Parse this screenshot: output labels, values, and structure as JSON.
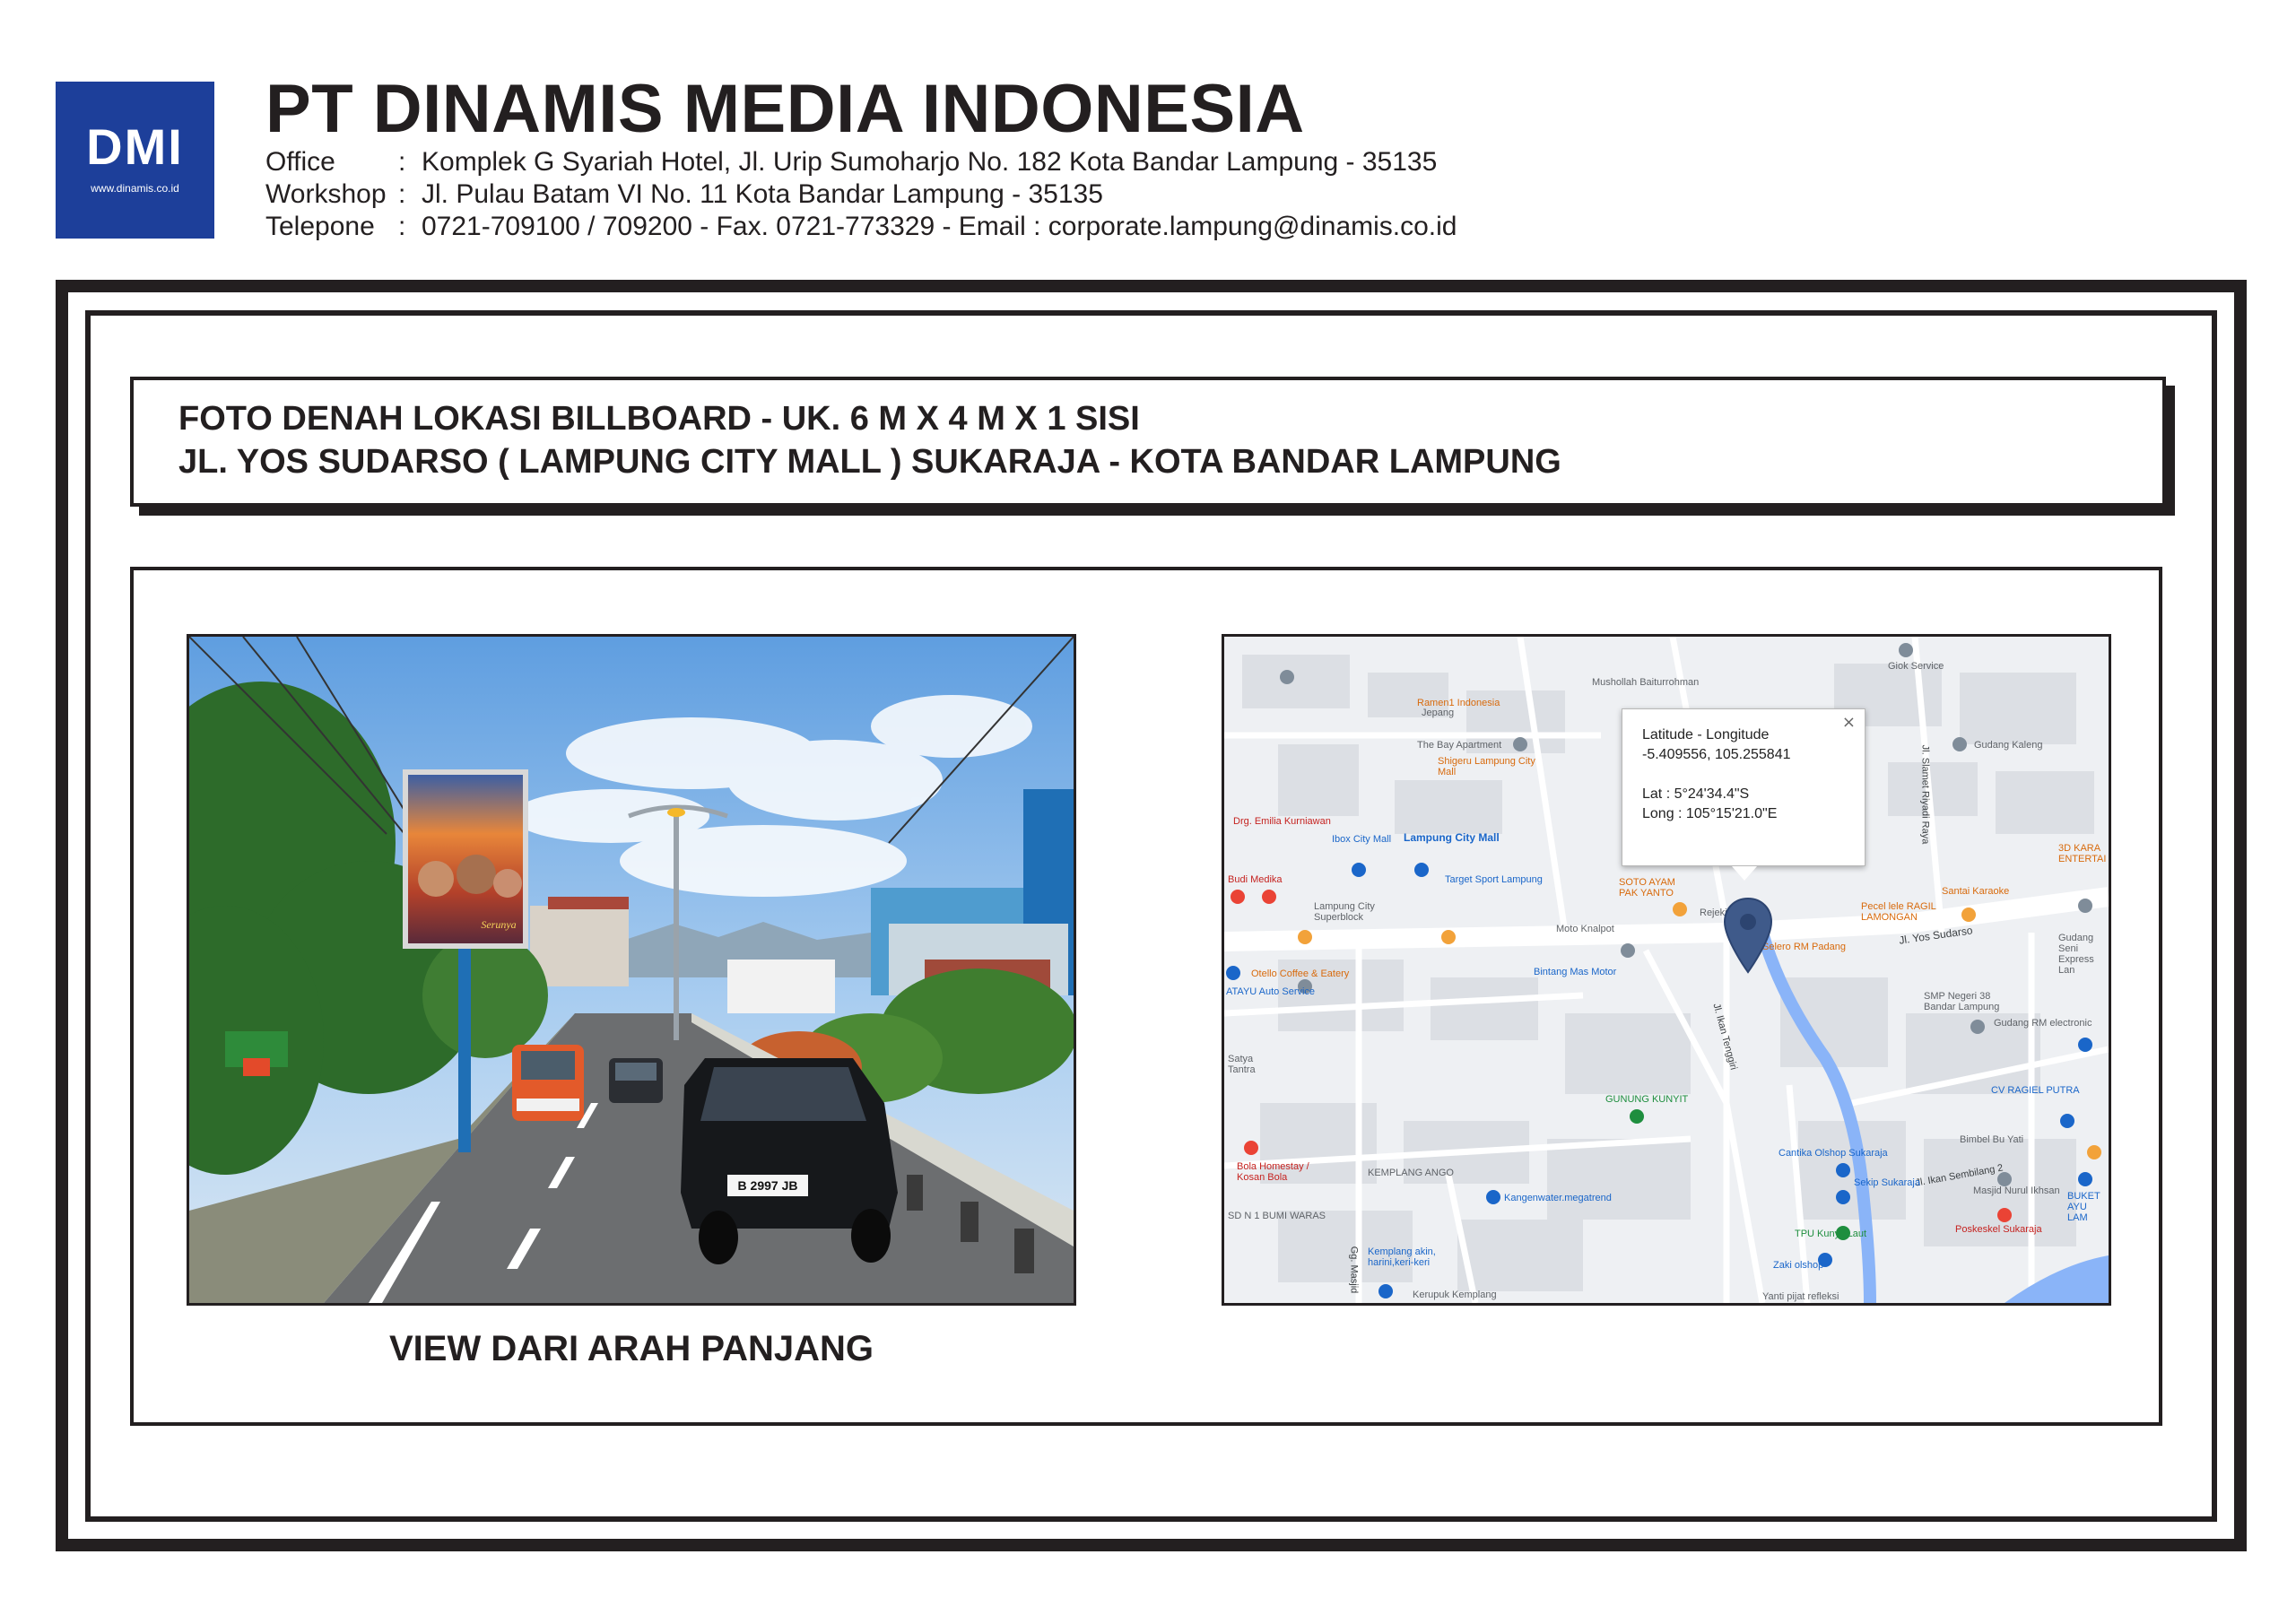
{
  "header": {
    "logo_text": "DMI",
    "logo_url": "www.dinamis.co.id",
    "company_name": "PT DINAMIS MEDIA INDONESIA",
    "office_label": "Office",
    "office_value": "Komplek G Syariah Hotel, Jl. Urip Sumoharjo No. 182 Kota Bandar Lampung - 35135",
    "workshop_label": "Workshop",
    "workshop_value": "Jl. Pulau Batam VI No. 11 Kota Bandar Lampung - 35135",
    "phone_label": "Telepone",
    "phone_value": "0721-709100 / 709200 - Fax. 0721-773329 - Email : corporate.lampung@dinamis.co.id",
    "separator": ":"
  },
  "title": {
    "line1": "FOTO DENAH LOKASI BILLBOARD - UK. 6 M X 4 M X 1 SISI",
    "line2": "JL. YOS SUDARSO ( LAMPUNG CITY MALL ) SUKARAJA - KOTA BANDAR LAMPUNG"
  },
  "photo": {
    "caption": "VIEW DARI ARAH PANJANG",
    "billboard_text": "Serunya",
    "plate": "B 2997 JB"
  },
  "map": {
    "popup": {
      "line1": "Latitude - Longitude",
      "line2": "-5.409556, 105.255841",
      "line3": "Lat : 5°24'34.4\"S",
      "line4": "Long : 105°15'21.0\"E",
      "close": "×"
    },
    "road_labels": [
      "Jl. Yos Sudarso",
      "Jl. Ikan Tenggiri",
      "Jl. Slamet Riyadi Raya",
      "Jl. Ikan Sembilang 2",
      "Gg. Masjid"
    ],
    "places": [
      {
        "name": "Mushollah Baiturrohman",
        "cls": "lbl-gray"
      },
      {
        "name": "Giok Service",
        "cls": "lbl-gray"
      },
      {
        "name": "Ramen1 Indonesia",
        "cls": "lbl-orange"
      },
      {
        "name": "Jepang",
        "cls": "lbl-gray"
      },
      {
        "name": "The Bay Apartment",
        "cls": "lbl-gray"
      },
      {
        "name": "Shigeru Lampung City Mall",
        "cls": "lbl-orange"
      },
      {
        "name": "Gudang Kaleng",
        "cls": "lbl-gray"
      },
      {
        "name": "Drg. Emilia Kurniawan",
        "cls": "lbl-red"
      },
      {
        "name": "Ibox City Mall",
        "cls": "lbl-blue"
      },
      {
        "name": "Lampung City Mall",
        "cls": "lbl-blue"
      },
      {
        "name": "Target Sport Lampung",
        "cls": "lbl-blue"
      },
      {
        "name": "Budi Medika",
        "cls": "lbl-red"
      },
      {
        "name": "Lampung City Superblock",
        "cls": "lbl-gray"
      },
      {
        "name": "SOTO AYAM PAK YANTO",
        "cls": "lbl-orange"
      },
      {
        "name": "Moto Knalpot",
        "cls": "lbl-gray"
      },
      {
        "name": "Rejeki C",
        "cls": "lbl-gray"
      },
      {
        "name": "Selero RM Padang",
        "cls": "lbl-orange"
      },
      {
        "name": "Pecel lele RAGIL LAMONGAN",
        "cls": "lbl-orange"
      },
      {
        "name": "Santai Karaoke",
        "cls": "lbl-orange"
      },
      {
        "name": "3D KARA ENTERTAI",
        "cls": "lbl-orange"
      },
      {
        "name": "Gudang Seni Express Lan",
        "cls": "lbl-gray"
      },
      {
        "name": "Otello Coffee & Eatery",
        "cls": "lbl-orange"
      },
      {
        "name": "ATAYU Auto Service",
        "cls": "lbl-blue"
      },
      {
        "name": "Bintang Mas Motor",
        "cls": "lbl-blue"
      },
      {
        "name": "SMP Negeri 38 Bandar Lampung",
        "cls": "lbl-gray"
      },
      {
        "name": "Gudang RM electronic",
        "cls": "lbl-gray"
      },
      {
        "name": "Satya Tantra",
        "cls": "lbl-gray"
      },
      {
        "name": "GUNUNG KUNYIT",
        "cls": "lbl-green"
      },
      {
        "name": "CV RAGIEL PUTRA",
        "cls": "lbl-blue"
      },
      {
        "name": "Bimbel Bu Yati",
        "cls": "lbl-gray"
      },
      {
        "name": "Bola Homestay / Kosan Bola",
        "cls": "lbl-red"
      },
      {
        "name": "KEMPLANG ANGO",
        "cls": "lbl-gray"
      },
      {
        "name": "Cantika Olshop Sukaraja",
        "cls": "lbl-blue"
      },
      {
        "name": "Sekip Sukaraja",
        "cls": "lbl-blue"
      },
      {
        "name": "Masjid Nurul Ikhsan",
        "cls": "lbl-gray"
      },
      {
        "name": "BUKET AYU LAM",
        "cls": "lbl-blue"
      },
      {
        "name": "Kangenwater.megatrend",
        "cls": "lbl-blue"
      },
      {
        "name": "SD N 1 BUMI WARAS",
        "cls": "lbl-gray"
      },
      {
        "name": "Poskeskel Sukaraja",
        "cls": "lbl-red"
      },
      {
        "name": "TPU Kunyit Laut",
        "cls": "lbl-green"
      },
      {
        "name": "Kemplang akin, harini,keri-keri",
        "cls": "lbl-blue"
      },
      {
        "name": "Zaki olshop",
        "cls": "lbl-blue"
      },
      {
        "name": "Kerupuk Kemplang",
        "cls": "lbl-gray"
      },
      {
        "name": "Yanti pijat refleksi",
        "cls": "lbl-gray"
      }
    ]
  }
}
